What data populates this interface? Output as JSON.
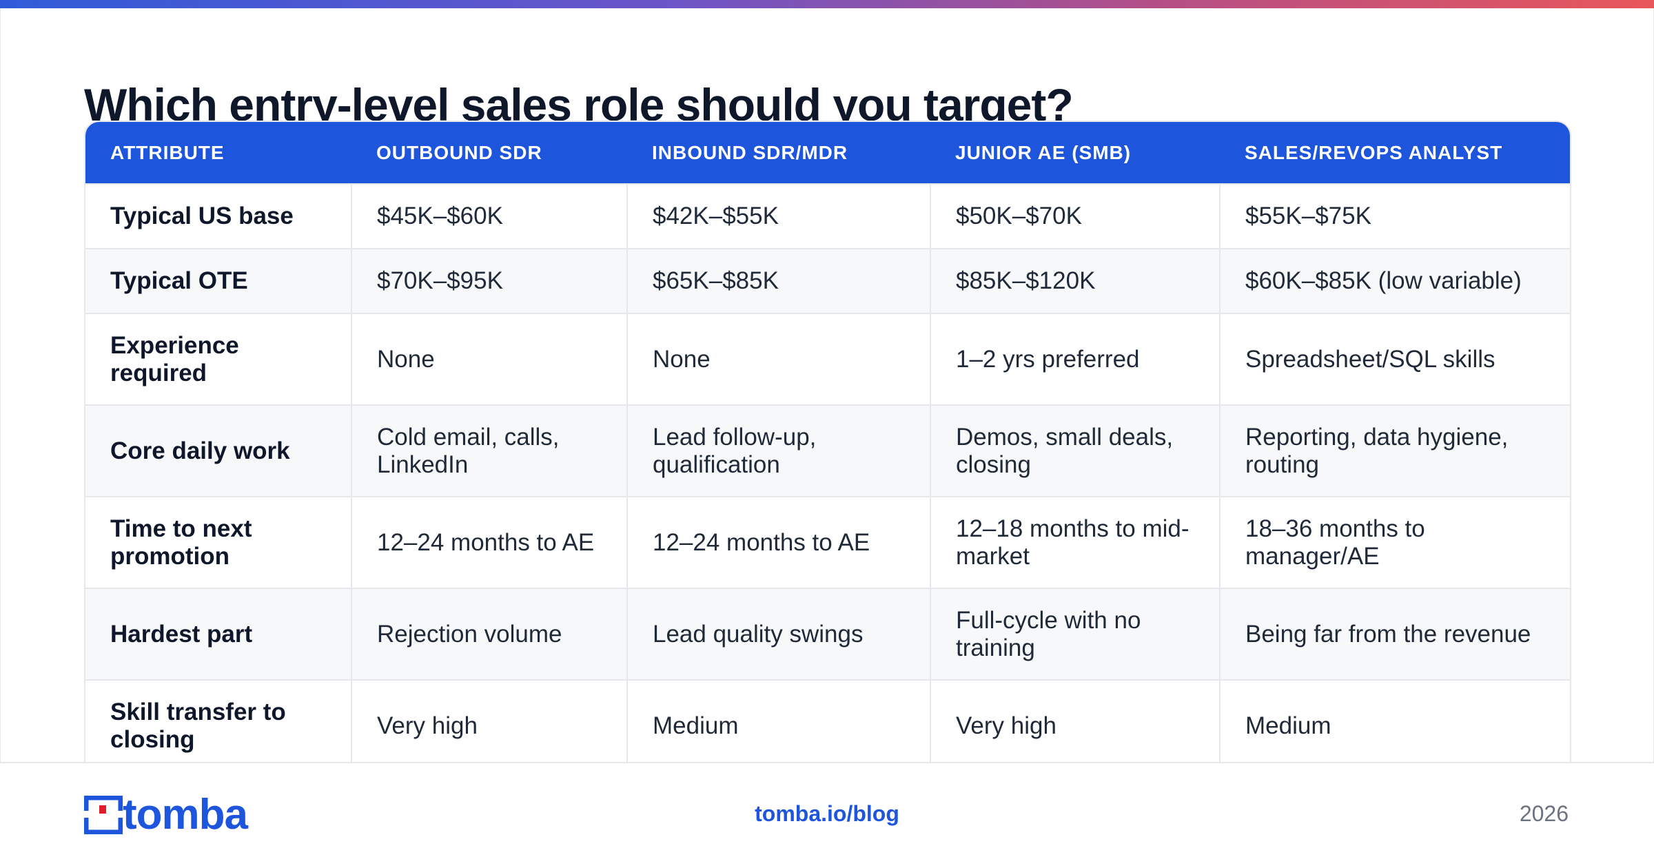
{
  "title": "Which entry-level sales role should you target?",
  "colors": {
    "accent": "#1d56dc",
    "logo_red": "#e11d2b",
    "gradient_start": "#2f5bd8",
    "gradient_end": "#e8575a"
  },
  "table": {
    "headers": [
      "ATTRIBUTE",
      "OUTBOUND SDR",
      "INBOUND SDR/MDR",
      "JUNIOR AE (SMB)",
      "SALES/REVOPS ANALYST"
    ],
    "rows": [
      [
        "Typical US base",
        "$45K–$60K",
        "$42K–$55K",
        "$50K–$70K",
        "$55K–$75K"
      ],
      [
        "Typical OTE",
        "$70K–$95K",
        "$65K–$85K",
        "$85K–$120K",
        "$60K–$85K (low variable)"
      ],
      [
        "Experience required",
        "None",
        "None",
        "1–2 yrs preferred",
        "Spreadsheet/SQL skills"
      ],
      [
        "Core daily work",
        "Cold email, calls, LinkedIn",
        "Lead follow-up, qualification",
        "Demos, small deals, closing",
        "Reporting, data hygiene, routing"
      ],
      [
        "Time to next promotion",
        "12–24 months to AE",
        "12–24 months to AE",
        "12–18 months to mid-market",
        "18–36 months to manager/AE"
      ],
      [
        "Hardest part",
        "Rejection volume",
        "Lead quality swings",
        "Full-cycle with no training",
        "Being far from the revenue"
      ],
      [
        "Skill transfer to closing",
        "Very high",
        "Medium",
        "Very high",
        "Medium"
      ]
    ]
  },
  "footer": {
    "logo_text": "tomba",
    "logo_icon": "tomba-logo-icon",
    "blog_link": "tomba.io/blog",
    "year": "2026"
  }
}
